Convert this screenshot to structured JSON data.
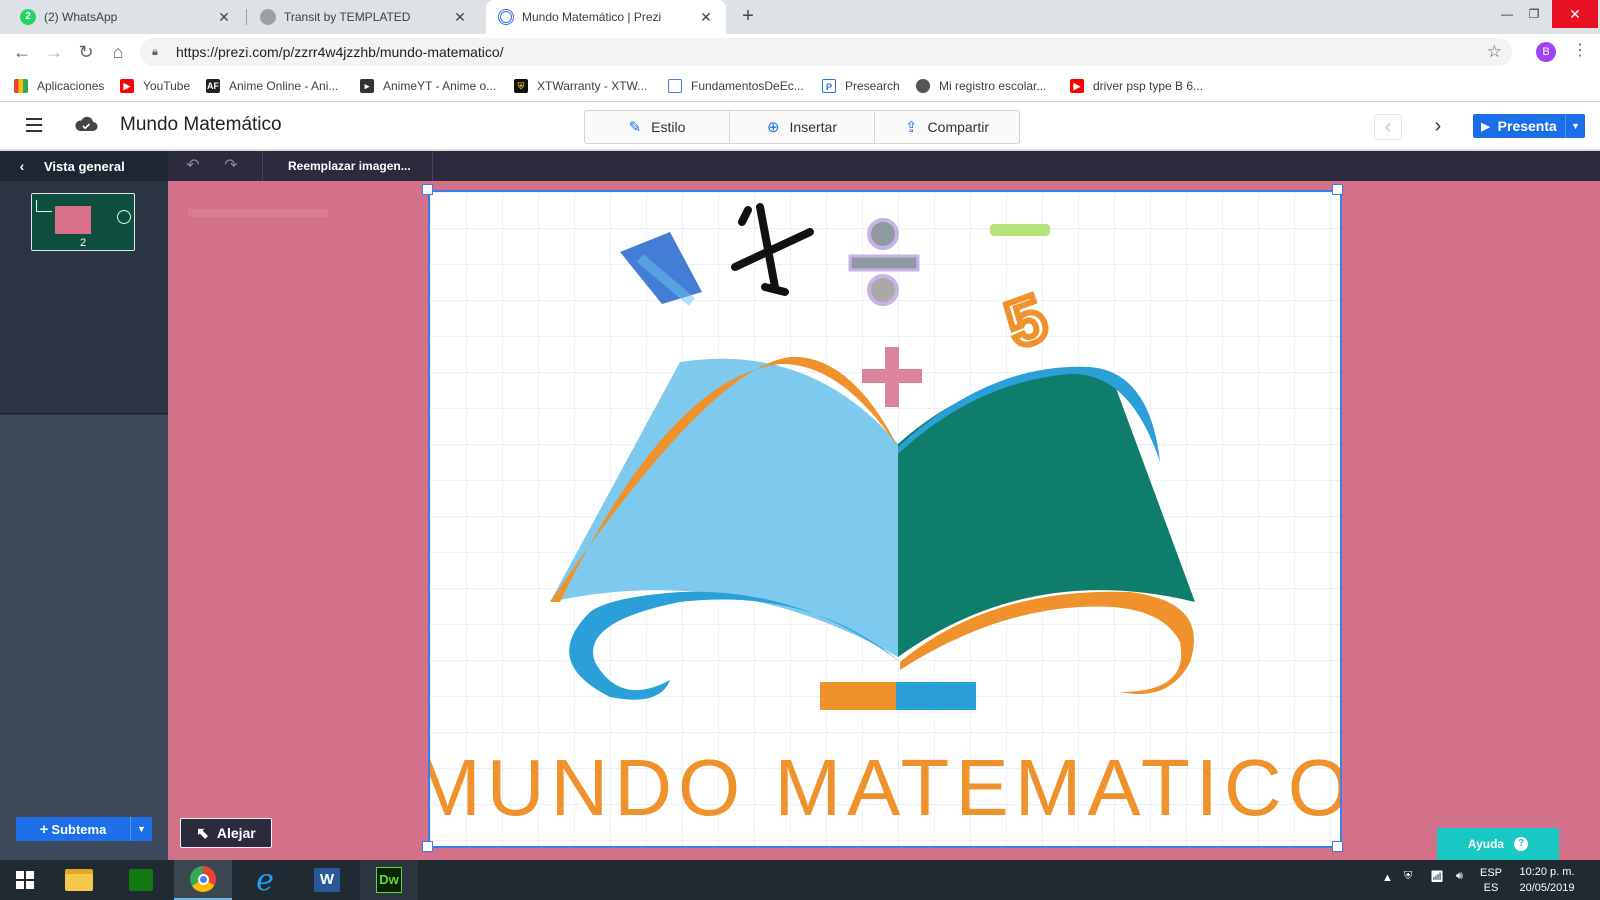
{
  "browser": {
    "tabs": [
      {
        "label": "(2) WhatsApp",
        "icon": "whatsapp-icon",
        "active": false
      },
      {
        "label": "Transit by TEMPLATED",
        "icon": "globe-icon",
        "active": false
      },
      {
        "label": "Mundo Matemático | Prezi",
        "icon": "prezi-icon",
        "active": true
      }
    ],
    "url": "https://prezi.com/p/zzrr4w4jzzhb/mundo-matematico/",
    "profile_initial": "B",
    "bookmarks": [
      {
        "label": "Aplicaciones",
        "icon": "apps-grid-icon",
        "color": "#4285f4"
      },
      {
        "label": "YouTube",
        "icon": "youtube-icon",
        "color": "#ff0000"
      },
      {
        "label": "Anime Online - Ani...",
        "icon": "anime-online-icon",
        "color": "#222222"
      },
      {
        "label": "AnimeYT - Anime o...",
        "icon": "animeyt-icon",
        "color": "#333333"
      },
      {
        "label": "XTWarranty - XTW...",
        "icon": "xtwarranty-icon",
        "color": "#b8860b"
      },
      {
        "label": "FundamentosDeEc...",
        "icon": "document-icon",
        "color": "#4b7bd6"
      },
      {
        "label": "Presearch",
        "icon": "presearch-icon",
        "color": "#2d6fe0"
      },
      {
        "label": "Mi registro escolar...",
        "icon": "globe-icon",
        "color": "#555555"
      },
      {
        "label": "driver psp type B 6...",
        "icon": "youtube-icon",
        "color": "#ff0000"
      }
    ]
  },
  "prezi": {
    "title": "Mundo Matemático",
    "actions": [
      {
        "label": "Estilo",
        "icon": "magic-wand-icon"
      },
      {
        "label": "Insertar",
        "icon": "plus-circle-icon"
      },
      {
        "label": "Compartir",
        "icon": "share-icon"
      }
    ],
    "present_label": "Presenta",
    "overview_label": "Vista general",
    "thumbnail_number": "2",
    "subtopic_label": "Subtema",
    "replace_image_label": "Reemplazar imagen...",
    "zoom_out_label": "Alejar",
    "help_label": "Ayuda",
    "canvas_color": "#d4718a",
    "accent_color": "#1c6fe8"
  },
  "artwork": {
    "logo_text": "MUNDO MATEMATICO",
    "symbols": [
      "1",
      "x",
      "÷",
      "−",
      "5",
      "+"
    ],
    "colors": {
      "orange": "#f0922b",
      "light_blue": "#7ec9ee",
      "teal": "#0e7d6c",
      "blue_arc": "#2b9fd8"
    }
  },
  "taskbar": {
    "apps": [
      {
        "name": "windows-start",
        "active": false
      },
      {
        "name": "file-explorer",
        "active": false
      },
      {
        "name": "store",
        "active": false
      },
      {
        "name": "chrome",
        "active": true
      },
      {
        "name": "internet-explorer",
        "active": false
      },
      {
        "name": "word",
        "active": false
      },
      {
        "name": "dreamweaver",
        "active": false
      }
    ],
    "lang_top": "ESP",
    "lang_bottom": "ES",
    "time": "10:20 p. m.",
    "date": "20/05/2019"
  }
}
